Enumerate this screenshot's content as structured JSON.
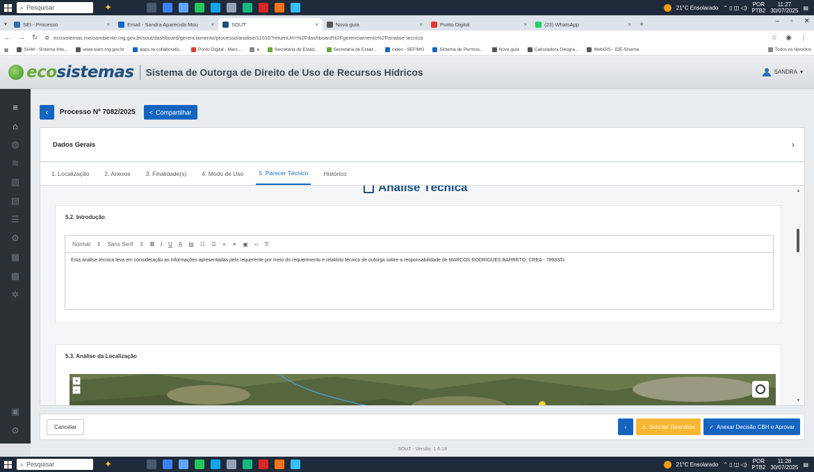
{
  "taskbar_top": {
    "search_label": "Pesquisar",
    "weather": "21°C Ensolarado",
    "lang_top": "POR",
    "lang_bottom": "PTB2",
    "time": "11:27",
    "date": "30/07/2025"
  },
  "taskbar_bottom": {
    "search_label": "Pesquisar",
    "weather": "21°C Ensolarado",
    "lang_top": "POR",
    "lang_bottom": "PTB2",
    "time": "11:28",
    "date": "30/07/2025"
  },
  "browser": {
    "tabs": [
      {
        "label": "SEI - Processo",
        "color": "#2e6fb0"
      },
      {
        "label": "Email - Sandra Aparecida Mou",
        "color": "#1565c0"
      },
      {
        "label": "SOUT",
        "color": "#1d4f7f"
      },
      {
        "label": "Nova guia",
        "color": "#555555"
      },
      {
        "label": "Ponto Digital",
        "color": "#e53935"
      },
      {
        "label": "(23) WhatsApp",
        "color": "#25d366"
      }
    ],
    "url": "ecosistemas.meioambiente.mg.gov.br/sout/dashboard/gerenciamento/processo/analise/11016?returnUrl=%2Fdashboard%2Fgerenciamento%2Fanalise-tecnica",
    "bookmarks": [
      {
        "label": "SIAM - Sistema Inte...",
        "color": "#555555"
      },
      {
        "label": "www.siam.mg.gov.br",
        "color": "#555555"
      },
      {
        "label": "apps.rw.collaborativ...",
        "color": "#1565c0"
      },
      {
        "label": "Ponto Digital - Marc...",
        "color": "#e53935"
      },
      {
        "label": "a",
        "color": "#888888"
      },
      {
        "label": "Secretaria de Estad...",
        "color": "#6aa83a"
      },
      {
        "label": "Secretaria de Estad...",
        "color": "#6aa83a"
      },
      {
        "label": "index - SEF/MG",
        "color": "#1565c0"
      },
      {
        "label": "Sistema de Permiss...",
        "color": "#1565c0"
      },
      {
        "label": "Nova guia",
        "color": "#555555"
      },
      {
        "label": "Calculadora Geogra...",
        "color": "#555555"
      },
      {
        "label": "WebGIS - IDE-Sisema",
        "color": "#555555"
      }
    ],
    "all_bookmarks": "Todos os favoritos"
  },
  "app": {
    "logo_eco": "eco",
    "logo_sis": "sistemas",
    "title": "Sistema de Outorga de Direito de Uso de Recursos Hídricos",
    "user": "SANDRA"
  },
  "process": {
    "title": "Processo Nº 7082/2025",
    "share": "Compartilhar",
    "dados_gerais": "Dados Gerais"
  },
  "tabs": [
    {
      "label": "1. Localização"
    },
    {
      "label": "2. Anexos"
    },
    {
      "label": "3. Finalidade(s)"
    },
    {
      "label": "4. Modo de Uso"
    },
    {
      "label": "5. Parecer Técnico"
    },
    {
      "label": "Histórico"
    }
  ],
  "analysis": {
    "title": "Análise Técnica",
    "intro_heading": "5.2. Introdução",
    "toolbar": {
      "format": "Normal",
      "font": "Sans Serif"
    },
    "intro_text": "Esta análise técnica leva em consideração as informações apresentadas pelo requerente por meio do requerimento e relatório técnico de outorga sobre a responsabilidade de MARCOS RODRIGUES BARRETO, CREA - 79933/D.",
    "loc_heading": "5.3. Análise da Localização"
  },
  "footer": {
    "cancel": "Cancelar",
    "request": "Solicitar Reanálise",
    "approve": "Anexar Decisão CBH e Aprovar"
  },
  "version": "SOUT - Versão: 1.6.18"
}
